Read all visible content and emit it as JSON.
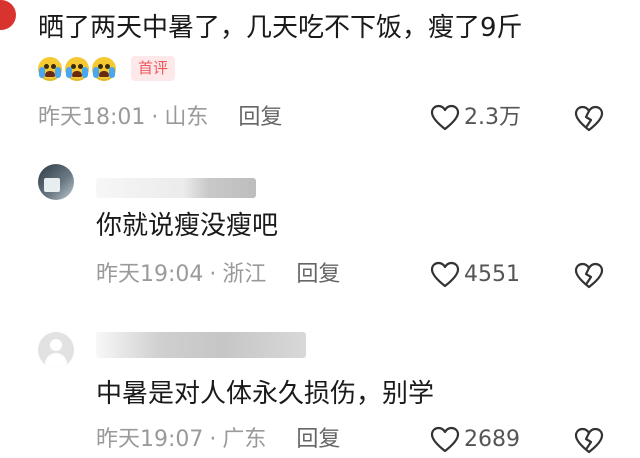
{
  "comments": [
    {
      "text": "晒了两天中暑了，几天吃不下饭，瘦了9斤",
      "badge": "首评",
      "time": "昨天18:01",
      "location": "山东",
      "reply_label": "回复",
      "likes": "2.3万",
      "emoji_icons": [
        "crying-laughing-emoji",
        "crying-laughing-emoji",
        "crying-laughing-emoji"
      ]
    }
  ],
  "replies": [
    {
      "text": "你就说瘦没瘦吧",
      "time": "昨天19:04",
      "location": "浙江",
      "reply_label": "回复",
      "likes": "4551"
    },
    {
      "text": "中暑是对人体永久损伤，别学",
      "time": "昨天19:07",
      "location": "广东",
      "reply_label": "回复",
      "likes": "2689"
    }
  ],
  "separator": "·",
  "colors": {
    "text": "#1a1a1a",
    "meta": "#9a9a9a",
    "badge_bg": "#fde9ea",
    "badge_text": "#f0585c",
    "emoji": "#f5c932"
  }
}
